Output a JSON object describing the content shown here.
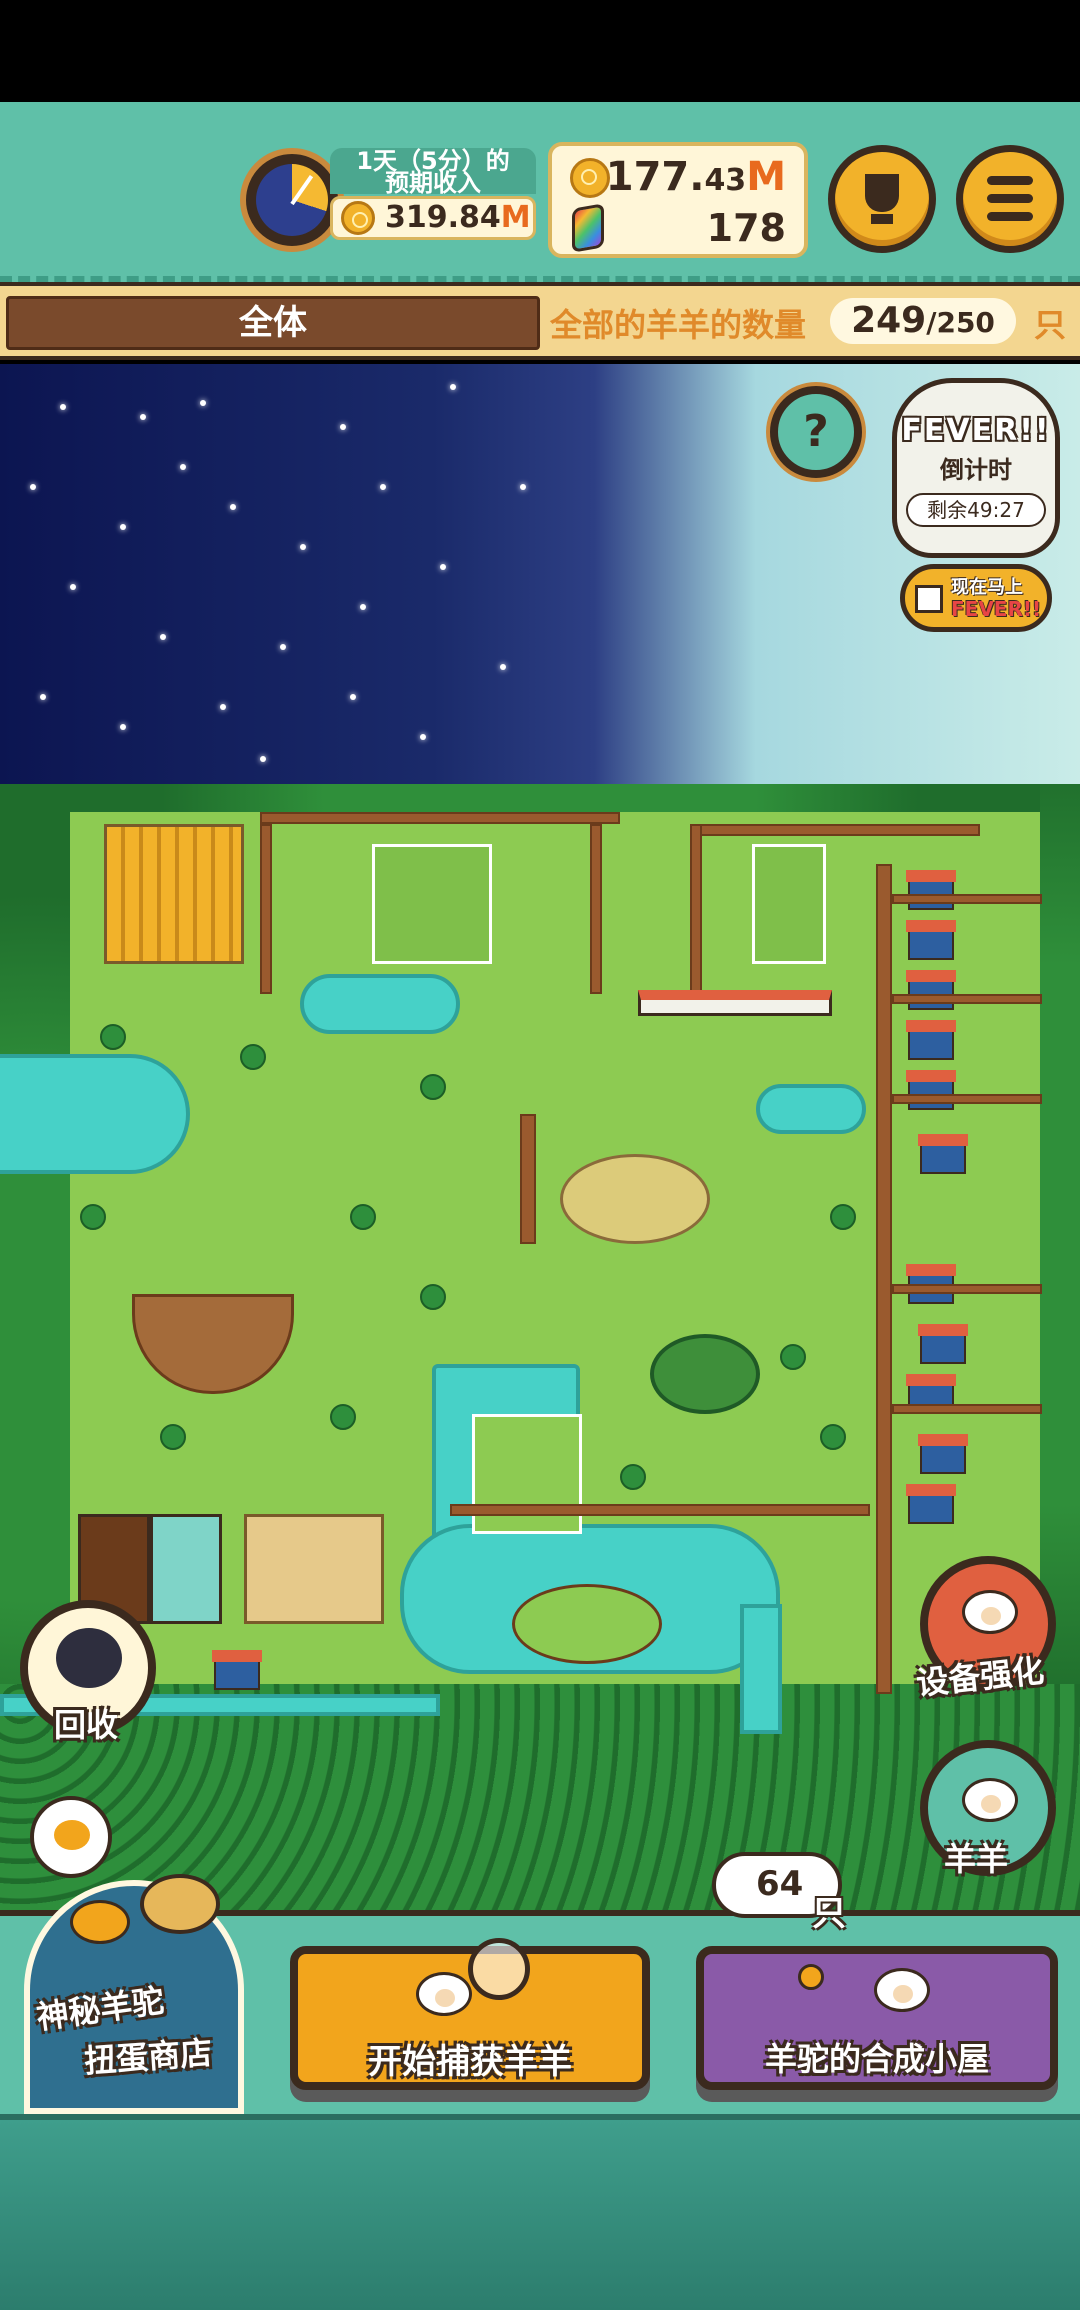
{
  "header": {
    "income_title": "1天（5分）的\n预期收入",
    "income_title_line1": "1天（5分）的",
    "income_title_line2": "预期收入",
    "income_value": "319.84",
    "income_unit": "M",
    "money_main": "177.",
    "money_decimal": "43",
    "money_unit": "M",
    "gems": "178"
  },
  "countbar": {
    "filter_label": "全体",
    "count_label": "全部的羊羊的数量",
    "current": "249",
    "total": "/250",
    "unit": "只"
  },
  "fever": {
    "title": "FEVER!!",
    "subtitle": "倒计时",
    "remaining": "剩余49:27",
    "now_line1": "现在马上",
    "now_line2": "FEVER!!"
  },
  "map_buttons": {
    "recycle": "回收",
    "upgrade": "设备强化",
    "sheep": "羊羊"
  },
  "bottom": {
    "shop_line1": "神秘羊驼",
    "shop_line2": "扭蛋商店",
    "catch_label": "开始捕获羊羊",
    "craft_label": "羊驼的合成小屋",
    "sheep_count": "64",
    "sheep_unit": "只"
  },
  "colors": {
    "teal": "#5fc0a8",
    "gold": "#f2b22a",
    "brown": "#3b2a1e",
    "accent_orange": "#e86a1e",
    "grass": "#8dcb52",
    "water": "#47d1c7"
  },
  "icons": [
    "compass-clock-icon",
    "coin-icon",
    "gem-icon",
    "trophy-icon",
    "menu-icon",
    "help-icon",
    "ticket-icon",
    "dog-icon",
    "sheep-icon",
    "net-icon",
    "joystick-icon"
  ]
}
